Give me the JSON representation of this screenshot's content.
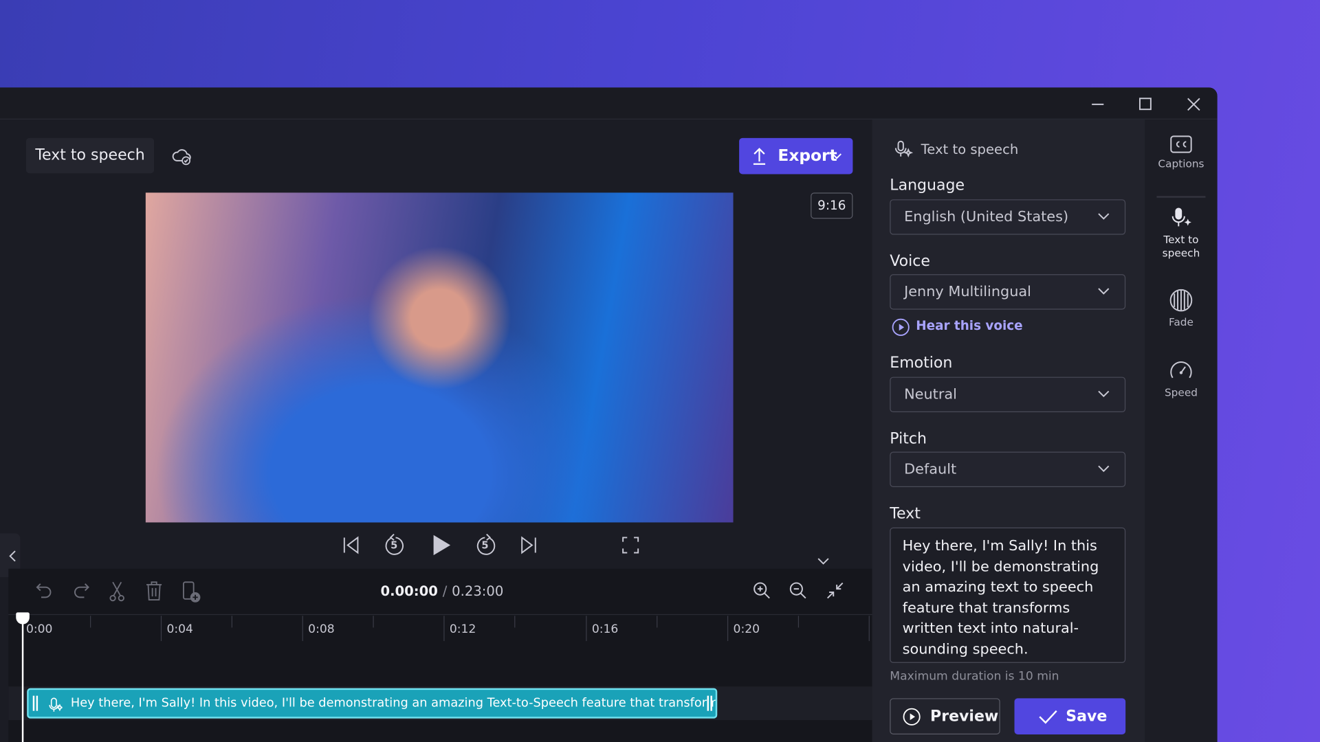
{
  "window": {
    "minimize_icon": "minimize-icon",
    "maximize_icon": "maximize-icon",
    "close_icon": "close-icon"
  },
  "header": {
    "project_title": "Text to speech",
    "save_status_icon": "cloud-check-icon",
    "export_label": "Export",
    "aspect_ratio": "9:16"
  },
  "player": {
    "controls": [
      "skip-back",
      "rewind-5",
      "play",
      "forward-5",
      "skip-forward",
      "fullscreen"
    ],
    "rewind_seconds": "5",
    "forward_seconds": "5"
  },
  "timeline": {
    "current_time": "0.00:00",
    "separator": "/",
    "total_time": "0.23:00",
    "ticks": [
      "0:00",
      "0:04",
      "0:08",
      "0:12",
      "0:16",
      "0:20"
    ],
    "clip_text": "Hey there, I'm Sally! In this video, I'll be demonstrating an amazing Text-to-Speech feature that transforms wri"
  },
  "panel": {
    "title": "Text to speech",
    "language_label": "Language",
    "language_value": "English (United States)",
    "voice_label": "Voice",
    "voice_value": "Jenny Multilingual",
    "hear_voice": "Hear this voice",
    "emotion_label": "Emotion",
    "emotion_value": "Neutral",
    "pitch_label": "Pitch",
    "pitch_value": "Default",
    "text_label": "Text",
    "text_value": "Hey there, I'm Sally! In this video, I'll be demonstrating an amazing text to speech feature that transforms written text into natural-sounding speech.",
    "max_duration": "Maximum duration is 10 min",
    "preview_label": "Preview",
    "save_label": "Save"
  },
  "sidebar": {
    "items": [
      {
        "label": "Captions",
        "icon": "cc-icon"
      },
      {
        "label": "Text to speech",
        "icon": "mic-sparkle-icon",
        "active": true
      },
      {
        "label": "Fade",
        "icon": "fade-icon"
      },
      {
        "label": "Speed",
        "icon": "speedometer-icon"
      }
    ]
  },
  "colors": {
    "accent": "#5146e0",
    "clip": "#1aa2b8",
    "link": "#a9a4ff"
  }
}
